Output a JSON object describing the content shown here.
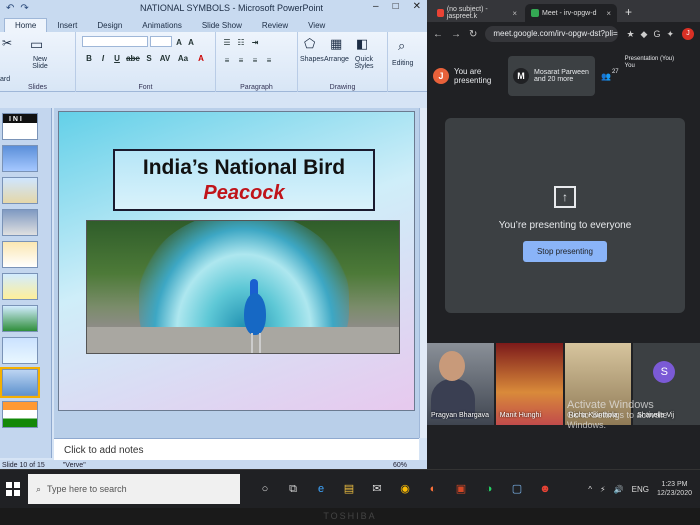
{
  "ppt": {
    "title": "NATIONAL SYMBOLS - Microsoft PowerPoint",
    "qat": [
      "↶",
      "↷"
    ],
    "win_controls": [
      "–",
      "□",
      "✕"
    ],
    "tabs": [
      "Home",
      "Insert",
      "Design",
      "Animations",
      "Slide Show",
      "Review",
      "View"
    ],
    "ribbon": {
      "new_slide": "New Slide",
      "groups": [
        "Slides",
        "Font",
        "Paragraph",
        "Drawing"
      ],
      "font_buttons": [
        "B",
        "I",
        "U",
        "abe",
        "S",
        "AV",
        "Aa",
        "A"
      ],
      "drawing_buttons": [
        "Shapes",
        "Arrange",
        "Quick Styles"
      ],
      "editing": "Editing",
      "clipboard_short": "ard"
    },
    "slide": {
      "title": "India’s National Bird",
      "subtitle": "Peacock"
    },
    "thumb_text": "I N I",
    "notes_placeholder": "Click to add notes",
    "status": {
      "slide_counter": "Slide 10 of 15",
      "theme": "\"Verve\"",
      "zoom": "60%"
    }
  },
  "chrome": {
    "tabs": [
      {
        "label": "(no subject) - jaspreet.k",
        "icon_color": "#ea4335"
      },
      {
        "label": "Meet - irv-opgw-d",
        "icon_color": "#34a853"
      }
    ],
    "new_tab": "+",
    "url": "meet.google.com/irv-opgw-dst?pli=1&",
    "nav": [
      "←",
      "→",
      "↻"
    ],
    "ext_icons": [
      "★",
      "◆",
      "G",
      "⬛",
      "✦"
    ],
    "profile_letter": "J"
  },
  "meet": {
    "you_badge": "J",
    "you_label": "You are presenting",
    "presenter_badge": "M",
    "presenter_label": "Mosarat Parween and 20 more",
    "participants_icon": "👥",
    "participants_count": "27",
    "presentation_label": "Presentation (You)",
    "you_tag": "You",
    "presenting_text": "You’re presenting to everyone",
    "stop_button": "Stop presenting",
    "tiles": [
      {
        "name": "Pragyan Bhargava"
      },
      {
        "name": "Manit Hunghi"
      },
      {
        "name": "Richa Kainthola"
      },
      {
        "name": "Shanelle Vij",
        "badge": "S"
      }
    ],
    "activate_title": "Activate Windows",
    "activate_sub": "Go to Settings to activate Windows."
  },
  "taskbar": {
    "search_placeholder": "Type here to search",
    "apps": [
      "○",
      "⧉",
      "e",
      "▤",
      "✉",
      "◉",
      "◐",
      "▣",
      "◑",
      "▢",
      "☻",
      "◎"
    ],
    "tray": [
      "^",
      "⚡",
      "🔊",
      "ENG"
    ],
    "time": "1:23 PM",
    "date": "12/23/2020"
  },
  "monitor_brand": "TOSHIBA"
}
